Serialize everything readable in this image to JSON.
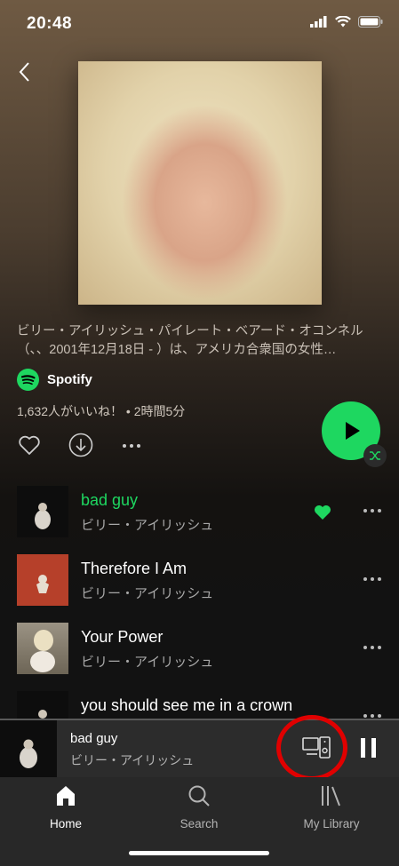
{
  "status": {
    "time": "20:48"
  },
  "description": "ビリー・アイリッシュ・パイレート・ベアード・オコンネル（、、2001年12月18日 - ）は、アメリカ合衆国の女性…",
  "owner": "Spotify",
  "likes": "1,632人がいいね！ • 2時間5分",
  "tracks": [
    {
      "title": "bad guy",
      "artist": "ビリー・アイリッシュ",
      "playing": true,
      "liked": true
    },
    {
      "title": "Therefore I Am",
      "artist": "ビリー・アイリッシュ"
    },
    {
      "title": "Your Power",
      "artist": "ビリー・アイリッシュ"
    },
    {
      "title": "you should see me in a crown",
      "artist": ""
    }
  ],
  "now_playing": {
    "title": "bad guy",
    "artist": "ビリー・アイリッシュ"
  },
  "tabs": {
    "home": "Home",
    "search": "Search",
    "library": "My Library"
  },
  "colors": {
    "accent": "#1ed760",
    "highlight": "#e00000"
  }
}
